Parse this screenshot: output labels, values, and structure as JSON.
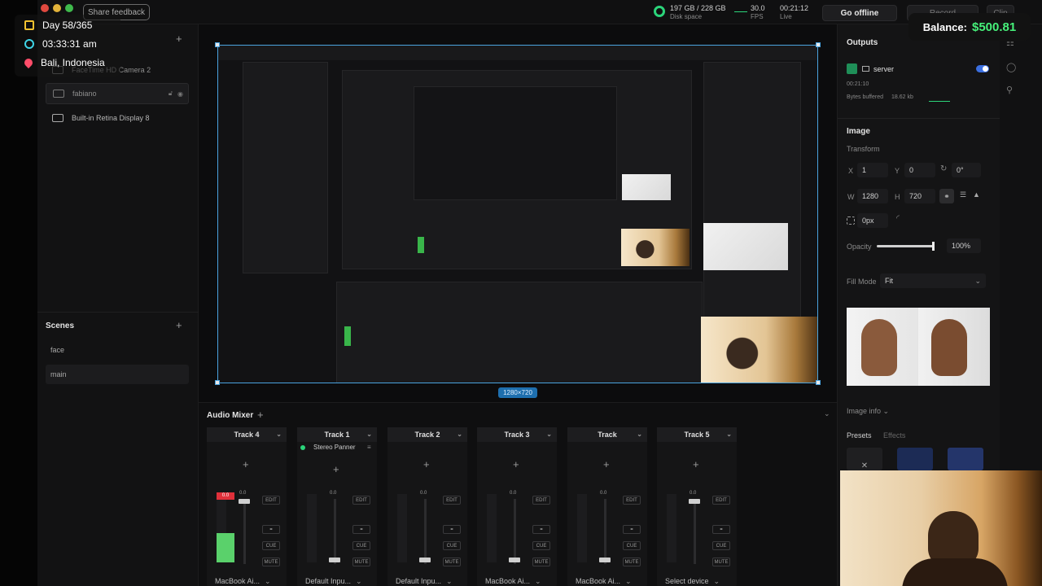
{
  "overlay": {
    "day": "Day 58/365",
    "time": "03:33:31 am",
    "location": "Bali, Indonesia",
    "balance_label": "Balance:",
    "balance_value": "$500.81"
  },
  "topbar": {
    "share_feedback": "Share feedback",
    "disk_space_value": "197 GB / 228 GB",
    "disk_space_label": "Disk space",
    "fps_value": "30.0",
    "fps_label": "FPS",
    "live_time": "00:21:12",
    "live_label": "Live",
    "go_offline": "Go offline",
    "record": "Record",
    "clip": "Clip"
  },
  "layers": {
    "items": [
      {
        "label": "FaceTime HD Camera 2"
      },
      {
        "label": "fabiano"
      },
      {
        "label": "Built-in Retina Display 8"
      }
    ]
  },
  "scenes": {
    "title": "Scenes",
    "items": [
      {
        "label": "face"
      },
      {
        "label": "main"
      }
    ]
  },
  "canvas": {
    "size_badge": "1280×720"
  },
  "mixer": {
    "title": "Audio Mixer",
    "tracks": [
      {
        "name": "Track 4",
        "device": "MacBook Ai...",
        "level": "0.0",
        "peak": "0.0"
      },
      {
        "name": "Track 1",
        "device": "Default Inpu...",
        "level": "0.0",
        "panner": "Stereo Panner"
      },
      {
        "name": "Track 2",
        "device": "Default Inpu...",
        "level": "0.0"
      },
      {
        "name": "Track 3",
        "device": "MacBook Ai...",
        "level": "0.0"
      },
      {
        "name": "Track",
        "device": "MacBook Ai...",
        "level": "0.0"
      },
      {
        "name": "Track 5",
        "device": "Select device",
        "level": "0.0"
      }
    ],
    "btn_edit": "EDIT",
    "btn_cue": "CUE",
    "btn_mute": "MUTE"
  },
  "outputs": {
    "title": "Outputs",
    "server_label": "server",
    "server_time": "00:21:10",
    "bytes_label": "Bytes buffered",
    "bytes_value": "18.62 kb"
  },
  "image": {
    "title": "Image",
    "transform_label": "Transform",
    "x_label": "X",
    "x_value": "1",
    "y_label": "Y",
    "y_value": "0",
    "rot_value": "0°",
    "w_label": "W",
    "w_value": "1280",
    "h_label": "H",
    "h_value": "720",
    "radius_value": "0px",
    "opacity_label": "Opacity",
    "opacity_value": "100%",
    "opacity_level": 1.0,
    "fill_mode_label": "Fill Mode",
    "fill_mode_value": "Fit",
    "image_info": "Image info",
    "presets_tab": "Presets",
    "effects_tab": "Effects"
  },
  "colors": {
    "accent_blue": "#4aa3df",
    "live_green": "#2bd47a",
    "balance_green": "#46f07a",
    "peak_red": "#e0303a"
  }
}
